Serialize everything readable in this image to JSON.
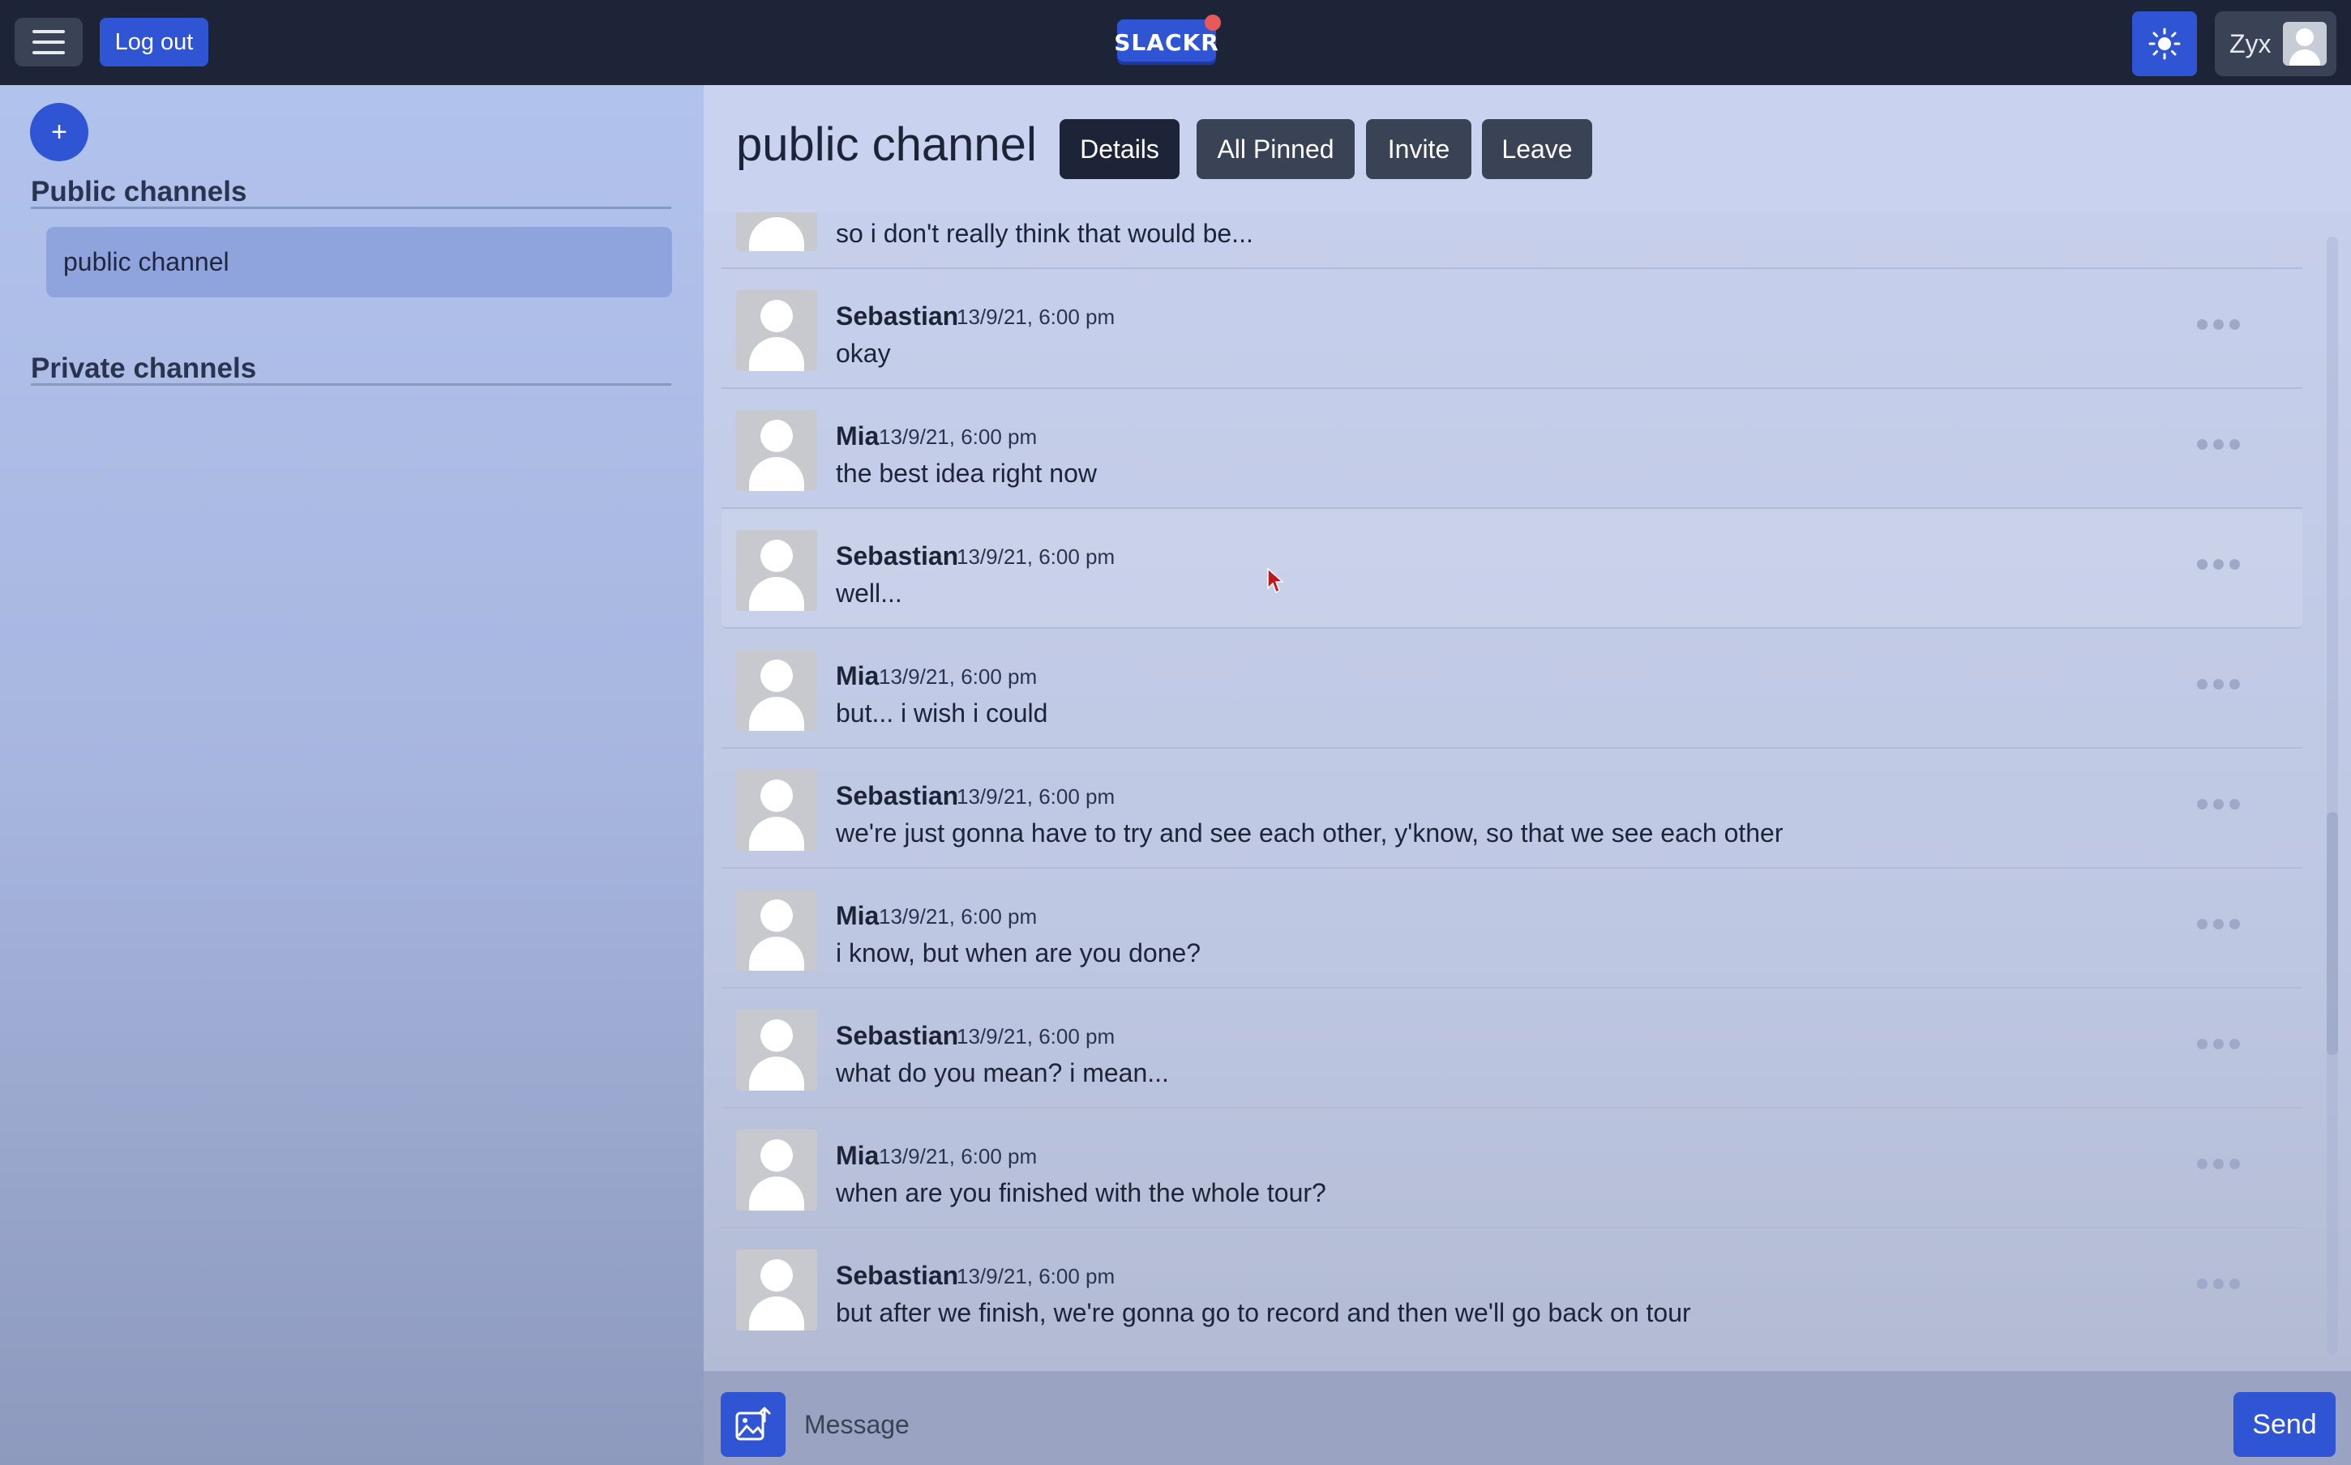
{
  "topbar": {
    "logout_label": "Log out",
    "logo_text": "SLACKR",
    "user_name": "Zyx"
  },
  "sidebar": {
    "public_title": "Public channels",
    "private_title": "Private channels",
    "add_label": "+",
    "public_channels": [
      "public channel"
    ]
  },
  "channel": {
    "name": "public channel",
    "buttons": {
      "details": "Details",
      "pinned": "All Pinned",
      "invite": "Invite",
      "leave": "Leave"
    }
  },
  "messages": [
    {
      "author": "",
      "time": "",
      "text": "so i don't really think that would be..."
    },
    {
      "author": "Sebastian",
      "time": "13/9/21, 6:00 pm",
      "text": "okay"
    },
    {
      "author": "Mia",
      "time": "13/9/21, 6:00 pm",
      "text": "the best idea right now"
    },
    {
      "author": "Sebastian",
      "time": "13/9/21, 6:00 pm",
      "text": "well..."
    },
    {
      "author": "Mia",
      "time": "13/9/21, 6:00 pm",
      "text": "but... i wish i could"
    },
    {
      "author": "Sebastian",
      "time": "13/9/21, 6:00 pm",
      "text": "we're just gonna have to try and see each other, y'know, so that we see each other"
    },
    {
      "author": "Mia",
      "time": "13/9/21, 6:00 pm",
      "text": "i know, but when are you done?"
    },
    {
      "author": "Sebastian",
      "time": "13/9/21, 6:00 pm",
      "text": "what do you mean? i mean..."
    },
    {
      "author": "Mia",
      "time": "13/9/21, 6:00 pm",
      "text": "when are you finished with the whole tour?"
    },
    {
      "author": "Sebastian",
      "time": "13/9/21, 6:00 pm",
      "text": "but after we finish, we're gonna go to record and then we'll go back on tour"
    }
  ],
  "composer": {
    "placeholder": "Message",
    "send_label": "Send"
  },
  "colors": {
    "accent": "#2f55d4",
    "topbar": "#1e2438",
    "sidebar": "#b1c2ec",
    "main": "#c3cbe6"
  },
  "icons": {
    "menu": "hamburger-icon",
    "theme": "sun-icon",
    "image_upload": "image-upload-icon",
    "more": "more-dots-icon"
  }
}
